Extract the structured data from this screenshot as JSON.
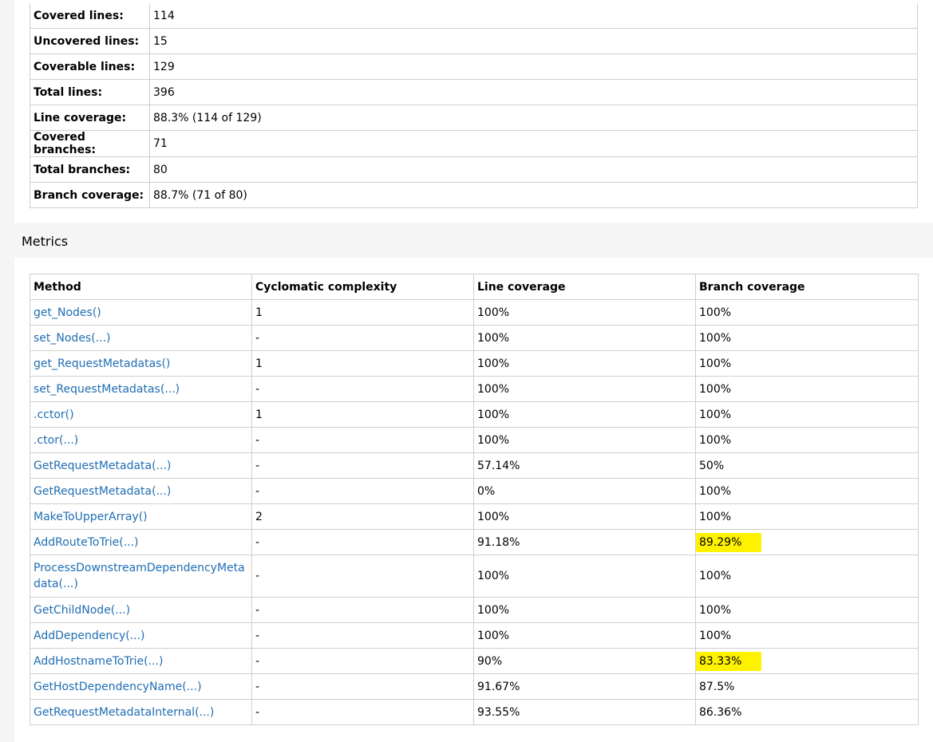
{
  "summary": {
    "rows": [
      {
        "key": "Covered lines:",
        "value": "114"
      },
      {
        "key": "Uncovered lines:",
        "value": "15"
      },
      {
        "key": "Coverable lines:",
        "value": "129"
      },
      {
        "key": "Total lines:",
        "value": "396"
      },
      {
        "key": "Line coverage:",
        "value": "88.3% (114 of 129)"
      },
      {
        "key": "Covered branches:",
        "value": "71"
      },
      {
        "key": "Total branches:",
        "value": "80"
      },
      {
        "key": "Branch coverage:",
        "value": "88.7% (71 of 80)"
      }
    ]
  },
  "metrics": {
    "title": "Metrics",
    "columns": [
      "Method",
      "Cyclomatic complexity",
      "Line coverage",
      "Branch coverage"
    ],
    "rows": [
      {
        "method": "get_Nodes()",
        "complexity": "1",
        "line": "100%",
        "branch": "100%"
      },
      {
        "method": "set_Nodes(...)",
        "complexity": "-",
        "line": "100%",
        "branch": "100%"
      },
      {
        "method": "get_RequestMetadatas()",
        "complexity": "1",
        "line": "100%",
        "branch": "100%"
      },
      {
        "method": "set_RequestMetadatas(...)",
        "complexity": "-",
        "line": "100%",
        "branch": "100%"
      },
      {
        "method": ".cctor()",
        "complexity": "1",
        "line": "100%",
        "branch": "100%"
      },
      {
        "method": ".ctor(...)",
        "complexity": "-",
        "line": "100%",
        "branch": "100%"
      },
      {
        "method": "GetRequestMetadata(...)",
        "complexity": "-",
        "line": "57.14%",
        "branch": "50%"
      },
      {
        "method": "GetRequestMetadata(...)",
        "complexity": "-",
        "line": "0%",
        "branch": "100%"
      },
      {
        "method": "MakeToUpperArray()",
        "complexity": "2",
        "line": "100%",
        "branch": "100%"
      },
      {
        "method": "AddRouteToTrie(...)",
        "complexity": "-",
        "line": "91.18%",
        "branch": "89.29%"
      },
      {
        "method": "ProcessDownstreamDependencyMetadata(...)",
        "complexity": "-",
        "line": "100%",
        "branch": "100%"
      },
      {
        "method": "GetChildNode(...)",
        "complexity": "-",
        "line": "100%",
        "branch": "100%"
      },
      {
        "method": "AddDependency(...)",
        "complexity": "-",
        "line": "100%",
        "branch": "100%"
      },
      {
        "method": "AddHostnameToTrie(...)",
        "complexity": "-",
        "line": "90%",
        "branch": "83.33%"
      },
      {
        "method": "GetHostDependencyName(...)",
        "complexity": "-",
        "line": "91.67%",
        "branch": "87.5%"
      },
      {
        "method": "GetRequestMetadataInternal(...)",
        "complexity": "-",
        "line": "93.55%",
        "branch": "86.36%"
      }
    ]
  },
  "colors": {
    "link": "#1f6db3",
    "highlight": "#fff200",
    "border": "#cfcfcf"
  }
}
